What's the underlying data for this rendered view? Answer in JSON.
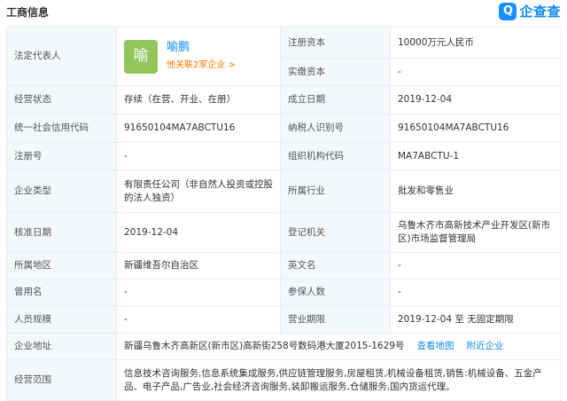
{
  "header": {
    "title": "工商信息",
    "logo_mark": "Q",
    "logo_text": "企查查"
  },
  "rep": {
    "label": "法定代表人",
    "avatar_char": "喻",
    "name": "喻鹏",
    "related": "他关联2家企业 >"
  },
  "fields": {
    "reg_capital": {
      "label": "注册资本",
      "value": "10000万元人民币"
    },
    "paid_capital": {
      "label": "实缴资本",
      "value": "-"
    },
    "status": {
      "label": "经营状态",
      "value": "存续（在营、开业、在册）"
    },
    "est_date": {
      "label": "成立日期",
      "value": "2019-12-04"
    },
    "credit_code": {
      "label": "统一社会信用代码",
      "value": "91650104MA7ABCTU16"
    },
    "taxpayer_id": {
      "label": "纳税人识别号",
      "value": "91650104MA7ABCTU16"
    },
    "reg_no": {
      "label": "注册号",
      "value": "-"
    },
    "org_code": {
      "label": "组织机构代码",
      "value": "MA7ABCTU-1"
    },
    "ent_type": {
      "label": "企业类型",
      "value": "有限责任公司（非自然人投资或控股的法人独资）"
    },
    "industry": {
      "label": "所属行业",
      "value": "批发和零售业"
    },
    "approve_date": {
      "label": "核准日期",
      "value": "2019-12-04"
    },
    "reg_authority": {
      "label": "登记机关",
      "value": "乌鲁木齐市高新技术产业开发区(新市区)市场监督管理局"
    },
    "region": {
      "label": "所属地区",
      "value": "新疆维吾尔自治区"
    },
    "en_name": {
      "label": "英文名",
      "value": "-"
    },
    "former_name": {
      "label": "曾用名",
      "value": "-"
    },
    "insured": {
      "label": "参保人数",
      "value": "-"
    },
    "staff_size": {
      "label": "人员规模",
      "value": "-"
    },
    "term": {
      "label": "营业期限",
      "value": "2019-12-04 至 无固定期限"
    },
    "address": {
      "label": "企业地址",
      "value": "新疆乌鲁木齐高新区(新市区)高新街258号数码港大厦2015-1629号",
      "map_link": "查看地图",
      "nearby_link": "附近企业"
    },
    "scope": {
      "label": "经营范围",
      "value": "信息技术咨询服务,信息系统集成服务,供应链管理服务,房屋租赁,机械设备租赁,销售:机械设备、五金产品、电子产品,广告业,社会经济咨询服务,装卸搬运服务,仓储服务,国内货运代理。"
    }
  },
  "colors": {
    "label_bg": "#f2f9fc",
    "border": "#e4eef6",
    "link": "#128bed",
    "orange": "#ff7d00",
    "avatar": "#92c55a"
  }
}
